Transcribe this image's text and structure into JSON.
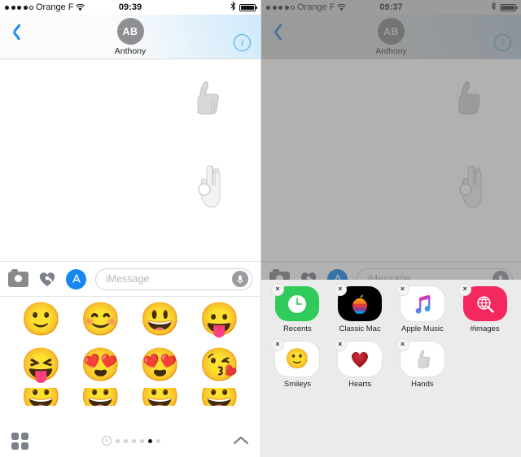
{
  "left": {
    "status": {
      "carrier": "Orange F",
      "time": "09:39",
      "signal_dots": 5,
      "signal_filled": 4,
      "wifi_icon": "wifi-icon",
      "bluetooth_icon": "bluetooth-icon",
      "battery_icon": "battery-full-icon"
    },
    "header": {
      "back_icon": "back-chevron-icon",
      "avatar_initials": "AB",
      "contact_name": "Anthony",
      "info_label": "i",
      "info_icon": "info-circle-icon"
    },
    "conversation": {
      "stickers": [
        {
          "name": "thumbs-up-sticker",
          "emoji": "thumbs-up"
        },
        {
          "name": "ok-hand-sticker",
          "emoji": "ok-hand"
        }
      ]
    },
    "toolbar": {
      "camera_icon": "camera-icon",
      "digital-touch_icon": "digital-touch-heart-icon",
      "appstore_icon": "app-store-icon",
      "appstore_label": "A",
      "input_placeholder": "iMessage",
      "input_value": "",
      "mic_icon": "microphone-icon"
    },
    "emoji_pane": {
      "rows": [
        [
          "slightly-smiling-face",
          "smiling-face",
          "grinning-face",
          "face-with-tongue"
        ],
        [
          "face-with-tongue-open-eyes",
          "smiling-face-heart-eyes-tongue",
          "smiling-face-with-heart-eyes",
          "winking-face-kiss"
        ],
        [
          "partial-row-top",
          "partial-row-top",
          "partial-row-top",
          "partial-row-top"
        ]
      ]
    },
    "bottom": {
      "grid_icon": "app-grid-icon",
      "recents_icon": "recents-clock-icon",
      "page_count": 6,
      "active_page": 5,
      "expand_icon": "chevron-up-icon"
    }
  },
  "right": {
    "status": {
      "carrier": "Orange F",
      "time": "09:37",
      "signal_dots": 5,
      "signal_filled": 4,
      "wifi_icon": "wifi-icon",
      "bluetooth_icon": "bluetooth-icon",
      "battery_icon": "battery-full-icon"
    },
    "header": {
      "back_icon": "back-chevron-icon",
      "avatar_initials": "AB",
      "contact_name": "Anthony",
      "info_label": "i",
      "info_icon": "info-circle-icon"
    },
    "toolbar": {
      "camera_icon": "camera-icon",
      "digital-touch_icon": "digital-touch-heart-icon",
      "appstore_icon": "app-store-icon",
      "appstore_label": "A",
      "input_placeholder": "iMessage",
      "input_value": "",
      "mic_icon": "microphone-icon"
    },
    "drawer": {
      "delete_badge": "×",
      "apps": [
        {
          "label": "Recents",
          "icon": "recents-clock-icon",
          "bg": "#2fcc5b",
          "deletable": true
        },
        {
          "label": "Classic Mac",
          "icon": "classic-mac-apple-icon",
          "bg": "#000000",
          "deletable": true
        },
        {
          "label": "Apple Music",
          "icon": "apple-music-note-icon",
          "bg": "#ffffff",
          "deletable": true
        },
        {
          "label": "#images",
          "icon": "images-search-icon",
          "bg": "#f4285e",
          "deletable": true
        },
        {
          "label": "Smileys",
          "icon": "smileys-emoji-icon",
          "bg": "#ffffff",
          "deletable": true
        },
        {
          "label": "Hearts",
          "icon": "hearts-emoji-icon",
          "bg": "#ffffff",
          "deletable": true
        },
        {
          "label": "Hands",
          "icon": "hands-emoji-icon",
          "bg": "#ffffff",
          "deletable": true
        }
      ]
    }
  },
  "colors": {
    "accent_blue": "#1787f0",
    "link_blue": "#1d8cf0",
    "avatar_gray": "#8e8e93",
    "drawer_bg": "#ebebeb",
    "recents_green": "#2fcc5b",
    "images_pink": "#f4285e"
  }
}
